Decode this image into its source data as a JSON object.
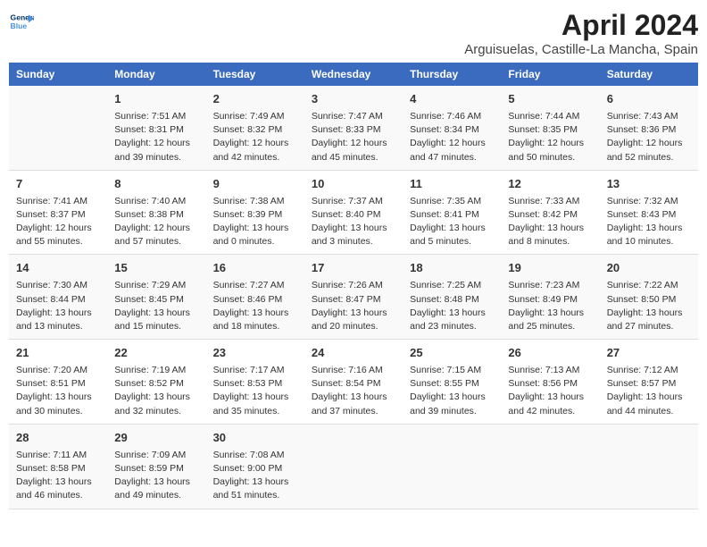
{
  "header": {
    "logo_line1": "General",
    "logo_line2": "Blue",
    "title": "April 2024",
    "subtitle": "Arguisuelas, Castille-La Mancha, Spain"
  },
  "calendar": {
    "days_of_week": [
      "Sunday",
      "Monday",
      "Tuesday",
      "Wednesday",
      "Thursday",
      "Friday",
      "Saturday"
    ],
    "weeks": [
      [
        {
          "day": "",
          "content": ""
        },
        {
          "day": "1",
          "content": "Sunrise: 7:51 AM\nSunset: 8:31 PM\nDaylight: 12 hours\nand 39 minutes."
        },
        {
          "day": "2",
          "content": "Sunrise: 7:49 AM\nSunset: 8:32 PM\nDaylight: 12 hours\nand 42 minutes."
        },
        {
          "day": "3",
          "content": "Sunrise: 7:47 AM\nSunset: 8:33 PM\nDaylight: 12 hours\nand 45 minutes."
        },
        {
          "day": "4",
          "content": "Sunrise: 7:46 AM\nSunset: 8:34 PM\nDaylight: 12 hours\nand 47 minutes."
        },
        {
          "day": "5",
          "content": "Sunrise: 7:44 AM\nSunset: 8:35 PM\nDaylight: 12 hours\nand 50 minutes."
        },
        {
          "day": "6",
          "content": "Sunrise: 7:43 AM\nSunset: 8:36 PM\nDaylight: 12 hours\nand 52 minutes."
        }
      ],
      [
        {
          "day": "7",
          "content": "Sunrise: 7:41 AM\nSunset: 8:37 PM\nDaylight: 12 hours\nand 55 minutes."
        },
        {
          "day": "8",
          "content": "Sunrise: 7:40 AM\nSunset: 8:38 PM\nDaylight: 12 hours\nand 57 minutes."
        },
        {
          "day": "9",
          "content": "Sunrise: 7:38 AM\nSunset: 8:39 PM\nDaylight: 13 hours\nand 0 minutes."
        },
        {
          "day": "10",
          "content": "Sunrise: 7:37 AM\nSunset: 8:40 PM\nDaylight: 13 hours\nand 3 minutes."
        },
        {
          "day": "11",
          "content": "Sunrise: 7:35 AM\nSunset: 8:41 PM\nDaylight: 13 hours\nand 5 minutes."
        },
        {
          "day": "12",
          "content": "Sunrise: 7:33 AM\nSunset: 8:42 PM\nDaylight: 13 hours\nand 8 minutes."
        },
        {
          "day": "13",
          "content": "Sunrise: 7:32 AM\nSunset: 8:43 PM\nDaylight: 13 hours\nand 10 minutes."
        }
      ],
      [
        {
          "day": "14",
          "content": "Sunrise: 7:30 AM\nSunset: 8:44 PM\nDaylight: 13 hours\nand 13 minutes."
        },
        {
          "day": "15",
          "content": "Sunrise: 7:29 AM\nSunset: 8:45 PM\nDaylight: 13 hours\nand 15 minutes."
        },
        {
          "day": "16",
          "content": "Sunrise: 7:27 AM\nSunset: 8:46 PM\nDaylight: 13 hours\nand 18 minutes."
        },
        {
          "day": "17",
          "content": "Sunrise: 7:26 AM\nSunset: 8:47 PM\nDaylight: 13 hours\nand 20 minutes."
        },
        {
          "day": "18",
          "content": "Sunrise: 7:25 AM\nSunset: 8:48 PM\nDaylight: 13 hours\nand 23 minutes."
        },
        {
          "day": "19",
          "content": "Sunrise: 7:23 AM\nSunset: 8:49 PM\nDaylight: 13 hours\nand 25 minutes."
        },
        {
          "day": "20",
          "content": "Sunrise: 7:22 AM\nSunset: 8:50 PM\nDaylight: 13 hours\nand 27 minutes."
        }
      ],
      [
        {
          "day": "21",
          "content": "Sunrise: 7:20 AM\nSunset: 8:51 PM\nDaylight: 13 hours\nand 30 minutes."
        },
        {
          "day": "22",
          "content": "Sunrise: 7:19 AM\nSunset: 8:52 PM\nDaylight: 13 hours\nand 32 minutes."
        },
        {
          "day": "23",
          "content": "Sunrise: 7:17 AM\nSunset: 8:53 PM\nDaylight: 13 hours\nand 35 minutes."
        },
        {
          "day": "24",
          "content": "Sunrise: 7:16 AM\nSunset: 8:54 PM\nDaylight: 13 hours\nand 37 minutes."
        },
        {
          "day": "25",
          "content": "Sunrise: 7:15 AM\nSunset: 8:55 PM\nDaylight: 13 hours\nand 39 minutes."
        },
        {
          "day": "26",
          "content": "Sunrise: 7:13 AM\nSunset: 8:56 PM\nDaylight: 13 hours\nand 42 minutes."
        },
        {
          "day": "27",
          "content": "Sunrise: 7:12 AM\nSunset: 8:57 PM\nDaylight: 13 hours\nand 44 minutes."
        }
      ],
      [
        {
          "day": "28",
          "content": "Sunrise: 7:11 AM\nSunset: 8:58 PM\nDaylight: 13 hours\nand 46 minutes."
        },
        {
          "day": "29",
          "content": "Sunrise: 7:09 AM\nSunset: 8:59 PM\nDaylight: 13 hours\nand 49 minutes."
        },
        {
          "day": "30",
          "content": "Sunrise: 7:08 AM\nSunset: 9:00 PM\nDaylight: 13 hours\nand 51 minutes."
        },
        {
          "day": "",
          "content": ""
        },
        {
          "day": "",
          "content": ""
        },
        {
          "day": "",
          "content": ""
        },
        {
          "day": "",
          "content": ""
        }
      ]
    ]
  }
}
